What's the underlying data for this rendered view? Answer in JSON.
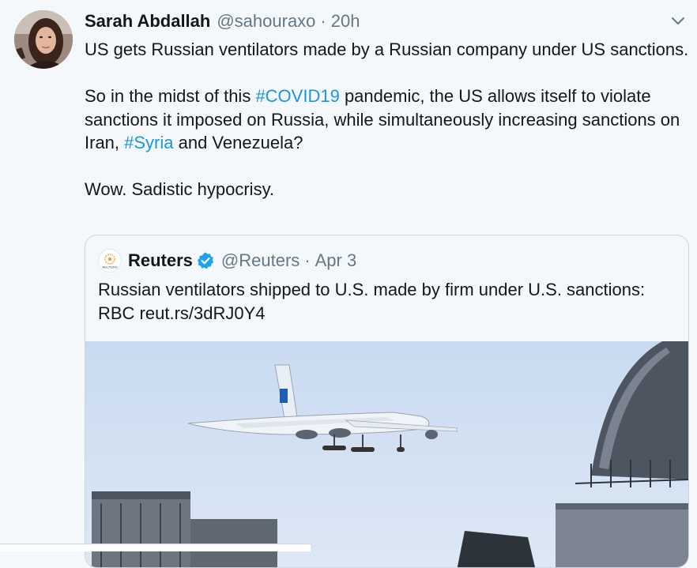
{
  "tweet": {
    "author_name": "Sarah Abdallah",
    "handle": "@sahouraxo",
    "separator": "·",
    "time": "20h",
    "line1": "US gets Russian ventilators made by a Russian company under US sanctions.",
    "p2_part1": "So in the midst of this ",
    "p2_hashtag1": "#COVID19",
    "p2_part2": " pandemic, the US allows itself to violate sanctions it imposed on Russia, while simultaneously increasing sanctions on Iran, ",
    "p2_hashtag2": "#Syria",
    "p2_part3": " and Venezuela?",
    "line3": "Wow. Sadistic hypocrisy."
  },
  "quote": {
    "author_name": "Reuters",
    "handle": "@Reuters",
    "separator": "·",
    "time": "Apr 3",
    "text_line1": "Russian ventilators shipped to U.S. made by firm under U.S. sanctions:",
    "text_line2": "RBC reut.rs/3dRJ0Y4",
    "logo_text": "REUTERS"
  },
  "icons": {
    "menu": "chevron-down-icon",
    "verified": "verified-badge-icon",
    "avatar": "user-avatar"
  },
  "colors": {
    "link": "#1b95e0",
    "secondary_text": "#657786",
    "verified": "#1da1f2",
    "background": "#f5f8fa"
  }
}
